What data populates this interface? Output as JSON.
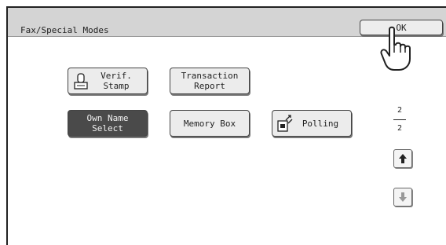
{
  "header": {
    "title": "Fax/Special Modes",
    "ok_label": "OK"
  },
  "buttons": [
    {
      "label": "Verif.\nStamp",
      "icon": "stamp-icon",
      "selected": false
    },
    {
      "label": "Transaction\nReport",
      "icon": null,
      "selected": false
    },
    {
      "label": "Own Name\nSelect",
      "icon": null,
      "selected": true
    },
    {
      "label": "Memory Box",
      "icon": null,
      "selected": false
    },
    {
      "label": "Polling",
      "icon": "polling-icon",
      "selected": false
    }
  ],
  "pagination": {
    "current": "2",
    "total": "2",
    "up_icon": "arrow-up-icon",
    "down_icon": "arrow-down-icon",
    "down_enabled": false
  },
  "pointer": {
    "icon": "pointing-hand-icon"
  },
  "colors": {
    "titlebar": "#d4d4d4",
    "button": "#ececec",
    "selected_button": "#4a4a4a"
  }
}
